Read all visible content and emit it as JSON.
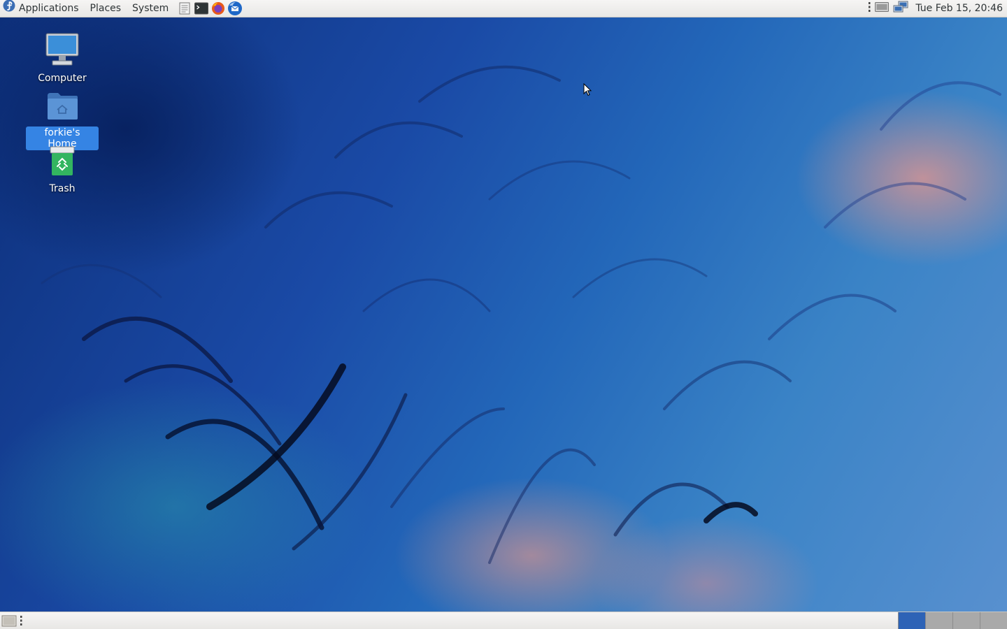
{
  "top_panel": {
    "menus": [
      "Applications",
      "Places",
      "System"
    ],
    "launchers": [
      "text-editor-icon",
      "terminal-icon",
      "firefox-icon",
      "thunderbird-icon"
    ],
    "tray_icons": [
      "tray-handle-icon",
      "keyboard-icon",
      "network-icon"
    ],
    "clock": "Tue Feb 15, 20:46"
  },
  "desktop": {
    "icons": [
      {
        "label": "Computer",
        "icon": "computer-icon"
      },
      {
        "label": "forkie's Home",
        "icon": "home-folder-icon",
        "selected": true
      },
      {
        "label": "Trash",
        "icon": "trash-icon"
      }
    ]
  },
  "bottom_panel": {
    "show_desktop": "show-desktop-icon",
    "workspaces": 4,
    "active_workspace": 1
  },
  "colors": {
    "panel_bg": "#edecea",
    "selection": "#3584e4",
    "active_workspace": "#2e63b6",
    "inactive_workspace": "#a9a9a9"
  }
}
